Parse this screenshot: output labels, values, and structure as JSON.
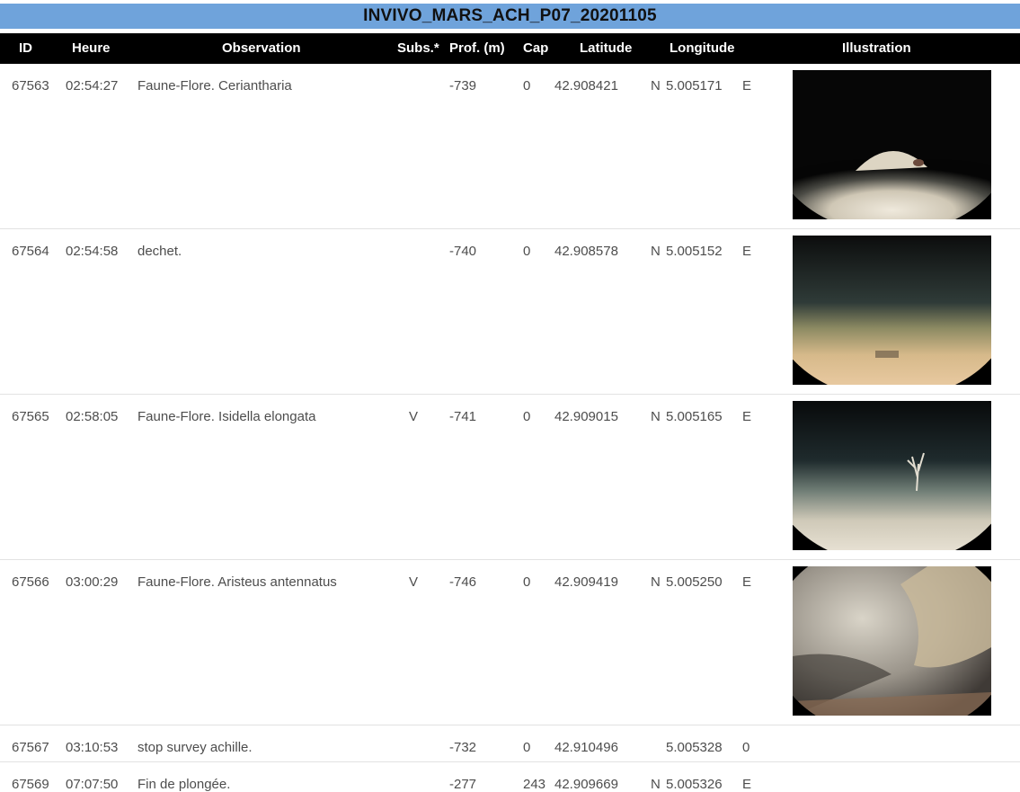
{
  "title": "INVIVO_MARS_ACH_P07_20201105",
  "columns": {
    "id": "ID",
    "heure": "Heure",
    "observation": "Observation",
    "subs": "Subs.*",
    "prof": "Prof. (m)",
    "cap": "Cap",
    "latitude": "Latitude",
    "longitude": "Longitude",
    "illustration": "Illustration"
  },
  "rows": [
    {
      "id": "67563",
      "heure": "02:54:27",
      "observation": "Faune-Flore. Ceriantharia",
      "subs": "",
      "prof": "-739",
      "cap": "0",
      "latitude": "42.908421",
      "lat_hemi": "N",
      "longitude": "5.005171",
      "lon_hemi": "E",
      "illustration": "seafloor-photo-mound"
    },
    {
      "id": "67564",
      "heure": "02:54:58",
      "observation": "dechet.",
      "subs": "",
      "prof": "-740",
      "cap": "0",
      "latitude": "42.908578",
      "lat_hemi": "N",
      "longitude": "5.005152",
      "lon_hemi": "E",
      "illustration": "seafloor-photo-debris"
    },
    {
      "id": "67565",
      "heure": "02:58:05",
      "observation": "Faune-Flore. Isidella elongata",
      "subs": "V",
      "prof": "-741",
      "cap": "0",
      "latitude": "42.909015",
      "lat_hemi": "N",
      "longitude": "5.005165",
      "lon_hemi": "E",
      "illustration": "seafloor-photo-coral"
    },
    {
      "id": "67566",
      "heure": "03:00:29",
      "observation": "Faune-Flore. Aristeus antennatus",
      "subs": "V",
      "prof": "-746",
      "cap": "0",
      "latitude": "42.909419",
      "lat_hemi": "N",
      "longitude": "5.005250",
      "lon_hemi": "E",
      "illustration": "seafloor-photo-turbid"
    },
    {
      "id": "67567",
      "heure": "03:10:53",
      "observation": "stop survey achille.",
      "subs": "",
      "prof": "-732",
      "cap": "0",
      "latitude": "42.910496",
      "lat_hemi": "",
      "longitude": "5.005328",
      "lon_hemi": "0",
      "illustration": ""
    },
    {
      "id": "67569",
      "heure": "07:07:50",
      "observation": "Fin de plongée.",
      "subs": "",
      "prof": "-277",
      "cap": "243",
      "latitude": "42.909669",
      "lat_hemi": "N",
      "longitude": "5.005326",
      "lon_hemi": "E",
      "illustration": ""
    }
  ]
}
